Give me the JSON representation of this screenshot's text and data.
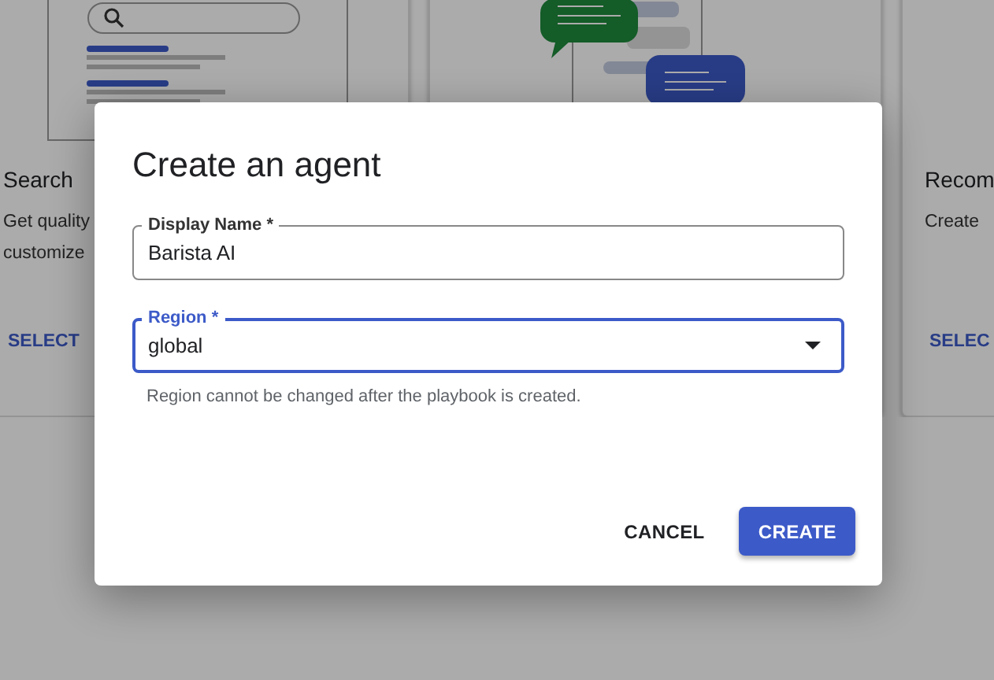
{
  "background_cards": [
    {
      "title": "Search",
      "description": [
        "Get quality",
        "customize"
      ],
      "action": "SELECT",
      "kind": "search"
    },
    {
      "kind": "chat"
    },
    {
      "title": "Recom",
      "description": [
        "Create"
      ],
      "action": "SELEC",
      "kind": "plain"
    }
  ],
  "dialog": {
    "title": "Create an agent",
    "fields": [
      {
        "kind": "text",
        "label": "Display Name *",
        "value": "Barista AI",
        "focused": false
      },
      {
        "kind": "select",
        "label": "Region *",
        "value": "global",
        "focused": true,
        "hint": "Region cannot be changed after the playbook is created."
      }
    ],
    "buttons": [
      {
        "label": "CANCEL",
        "primary": false
      },
      {
        "label": "CREATE",
        "primary": true
      }
    ]
  }
}
